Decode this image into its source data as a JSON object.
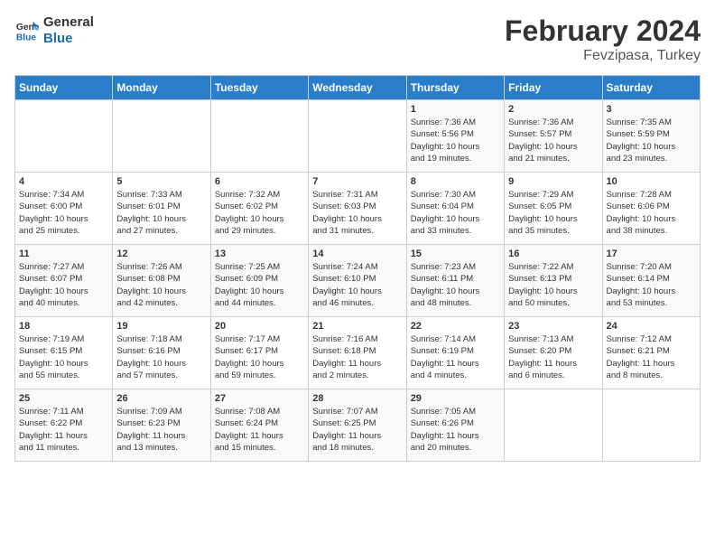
{
  "logo": {
    "line1": "General",
    "line2": "Blue"
  },
  "title": "February 2024",
  "subtitle": "Fevzipasa, Turkey",
  "days_header": [
    "Sunday",
    "Monday",
    "Tuesday",
    "Wednesday",
    "Thursday",
    "Friday",
    "Saturday"
  ],
  "weeks": [
    [
      {
        "day": "",
        "info": ""
      },
      {
        "day": "",
        "info": ""
      },
      {
        "day": "",
        "info": ""
      },
      {
        "day": "",
        "info": ""
      },
      {
        "day": "1",
        "info": "Sunrise: 7:36 AM\nSunset: 5:56 PM\nDaylight: 10 hours\nand 19 minutes."
      },
      {
        "day": "2",
        "info": "Sunrise: 7:36 AM\nSunset: 5:57 PM\nDaylight: 10 hours\nand 21 minutes."
      },
      {
        "day": "3",
        "info": "Sunrise: 7:35 AM\nSunset: 5:59 PM\nDaylight: 10 hours\nand 23 minutes."
      }
    ],
    [
      {
        "day": "4",
        "info": "Sunrise: 7:34 AM\nSunset: 6:00 PM\nDaylight: 10 hours\nand 25 minutes."
      },
      {
        "day": "5",
        "info": "Sunrise: 7:33 AM\nSunset: 6:01 PM\nDaylight: 10 hours\nand 27 minutes."
      },
      {
        "day": "6",
        "info": "Sunrise: 7:32 AM\nSunset: 6:02 PM\nDaylight: 10 hours\nand 29 minutes."
      },
      {
        "day": "7",
        "info": "Sunrise: 7:31 AM\nSunset: 6:03 PM\nDaylight: 10 hours\nand 31 minutes."
      },
      {
        "day": "8",
        "info": "Sunrise: 7:30 AM\nSunset: 6:04 PM\nDaylight: 10 hours\nand 33 minutes."
      },
      {
        "day": "9",
        "info": "Sunrise: 7:29 AM\nSunset: 6:05 PM\nDaylight: 10 hours\nand 35 minutes."
      },
      {
        "day": "10",
        "info": "Sunrise: 7:28 AM\nSunset: 6:06 PM\nDaylight: 10 hours\nand 38 minutes."
      }
    ],
    [
      {
        "day": "11",
        "info": "Sunrise: 7:27 AM\nSunset: 6:07 PM\nDaylight: 10 hours\nand 40 minutes."
      },
      {
        "day": "12",
        "info": "Sunrise: 7:26 AM\nSunset: 6:08 PM\nDaylight: 10 hours\nand 42 minutes."
      },
      {
        "day": "13",
        "info": "Sunrise: 7:25 AM\nSunset: 6:09 PM\nDaylight: 10 hours\nand 44 minutes."
      },
      {
        "day": "14",
        "info": "Sunrise: 7:24 AM\nSunset: 6:10 PM\nDaylight: 10 hours\nand 46 minutes."
      },
      {
        "day": "15",
        "info": "Sunrise: 7:23 AM\nSunset: 6:11 PM\nDaylight: 10 hours\nand 48 minutes."
      },
      {
        "day": "16",
        "info": "Sunrise: 7:22 AM\nSunset: 6:13 PM\nDaylight: 10 hours\nand 50 minutes."
      },
      {
        "day": "17",
        "info": "Sunrise: 7:20 AM\nSunset: 6:14 PM\nDaylight: 10 hours\nand 53 minutes."
      }
    ],
    [
      {
        "day": "18",
        "info": "Sunrise: 7:19 AM\nSunset: 6:15 PM\nDaylight: 10 hours\nand 55 minutes."
      },
      {
        "day": "19",
        "info": "Sunrise: 7:18 AM\nSunset: 6:16 PM\nDaylight: 10 hours\nand 57 minutes."
      },
      {
        "day": "20",
        "info": "Sunrise: 7:17 AM\nSunset: 6:17 PM\nDaylight: 10 hours\nand 59 minutes."
      },
      {
        "day": "21",
        "info": "Sunrise: 7:16 AM\nSunset: 6:18 PM\nDaylight: 11 hours\nand 2 minutes."
      },
      {
        "day": "22",
        "info": "Sunrise: 7:14 AM\nSunset: 6:19 PM\nDaylight: 11 hours\nand 4 minutes."
      },
      {
        "day": "23",
        "info": "Sunrise: 7:13 AM\nSunset: 6:20 PM\nDaylight: 11 hours\nand 6 minutes."
      },
      {
        "day": "24",
        "info": "Sunrise: 7:12 AM\nSunset: 6:21 PM\nDaylight: 11 hours\nand 8 minutes."
      }
    ],
    [
      {
        "day": "25",
        "info": "Sunrise: 7:11 AM\nSunset: 6:22 PM\nDaylight: 11 hours\nand 11 minutes."
      },
      {
        "day": "26",
        "info": "Sunrise: 7:09 AM\nSunset: 6:23 PM\nDaylight: 11 hours\nand 13 minutes."
      },
      {
        "day": "27",
        "info": "Sunrise: 7:08 AM\nSunset: 6:24 PM\nDaylight: 11 hours\nand 15 minutes."
      },
      {
        "day": "28",
        "info": "Sunrise: 7:07 AM\nSunset: 6:25 PM\nDaylight: 11 hours\nand 18 minutes."
      },
      {
        "day": "29",
        "info": "Sunrise: 7:05 AM\nSunset: 6:26 PM\nDaylight: 11 hours\nand 20 minutes."
      },
      {
        "day": "",
        "info": ""
      },
      {
        "day": "",
        "info": ""
      }
    ]
  ]
}
